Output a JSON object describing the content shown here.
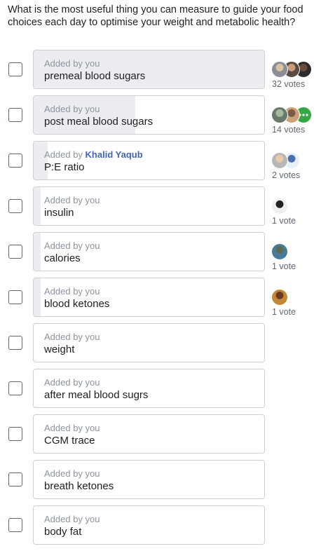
{
  "question": "What is the most useful thing you can measure to guide your food choices each day to optimise your weight and metabolic health?",
  "added_by_prefix": "Added by",
  "options": [
    {
      "added_by": "you",
      "label": "premeal blood sugars",
      "votes": 32,
      "vote_label": "32 votes",
      "fill_fraction": 1.0,
      "voter_avatars": [
        "avatar-photo",
        "avatar-photo",
        "avatar-photo"
      ]
    },
    {
      "added_by": "you",
      "label": "post meal blood sugars",
      "votes": 14,
      "vote_label": "14 votes",
      "fill_fraction": 0.44,
      "voter_avatars": [
        "avatar-photo",
        "avatar-photo",
        "more-voters-icon"
      ]
    },
    {
      "added_by": "Khalid Yaqub",
      "label": "P:E ratio",
      "votes": 2,
      "vote_label": "2 votes",
      "fill_fraction": 0.06,
      "voter_avatars": [
        "avatar-photo",
        "avatar-photo"
      ]
    },
    {
      "added_by": "you",
      "label": "insulin",
      "votes": 1,
      "vote_label": "1 vote",
      "fill_fraction": 0.03,
      "voter_avatars": [
        "avatar-photo"
      ]
    },
    {
      "added_by": "you",
      "label": "calories",
      "votes": 1,
      "vote_label": "1 vote",
      "fill_fraction": 0.03,
      "voter_avatars": [
        "avatar-photo"
      ]
    },
    {
      "added_by": "you",
      "label": "blood ketones",
      "votes": 1,
      "vote_label": "1 vote",
      "fill_fraction": 0.03,
      "voter_avatars": [
        "avatar-photo"
      ]
    },
    {
      "added_by": "you",
      "label": "weight",
      "votes": 0,
      "vote_label": "",
      "fill_fraction": 0,
      "voter_avatars": []
    },
    {
      "added_by": "you",
      "label": "after meal blood sugrs",
      "votes": 0,
      "vote_label": "",
      "fill_fraction": 0,
      "voter_avatars": []
    },
    {
      "added_by": "you",
      "label": "CGM trace",
      "votes": 0,
      "vote_label": "",
      "fill_fraction": 0,
      "voter_avatars": []
    },
    {
      "added_by": "you",
      "label": "breath ketones",
      "votes": 0,
      "vote_label": "",
      "fill_fraction": 0,
      "voter_avatars": []
    },
    {
      "added_by": "you",
      "label": "body fat",
      "votes": 0,
      "vote_label": "",
      "fill_fraction": 0,
      "voter_avatars": []
    }
  ],
  "colors": {
    "fill": "#ebedf0",
    "author_link": "#4267b2",
    "border": "#ccd0d5"
  }
}
